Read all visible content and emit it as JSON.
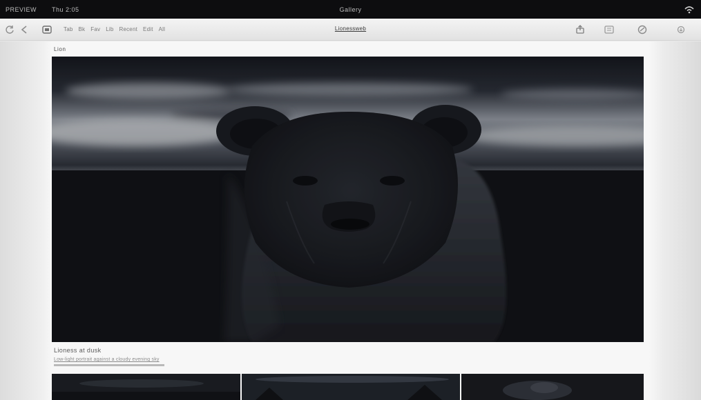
{
  "statusbar": {
    "left_text_1": "PREVIEW",
    "left_text_2": "Thu 2:05",
    "center_text": "Gallery",
    "right_icon": "wifi-icon"
  },
  "toolbar": {
    "icons": [
      "refresh-icon",
      "back-icon",
      "tab-icon",
      "share-icon",
      "bookmark-icon",
      "settings-icon",
      "download-icon"
    ],
    "links": [
      "Tab",
      "Bk",
      "Fav",
      "Lib",
      "Recent",
      "Edit",
      "All"
    ],
    "page_title": "Lionessweb"
  },
  "content": {
    "section_label": "Lion",
    "caption": "Lioness at dusk",
    "description": "Low-light portrait against a cloudy evening sky"
  },
  "colors": {
    "status_bg": "#0d0d0f",
    "toolbar_bg": "#e8e8e8",
    "hero_bg": "#141519"
  }
}
